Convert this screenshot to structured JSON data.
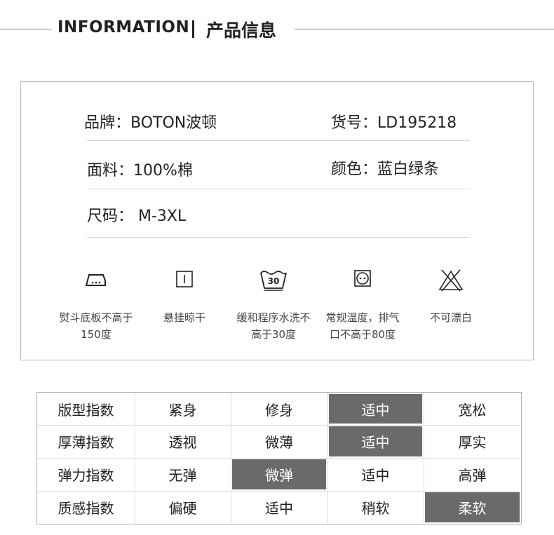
{
  "header": {
    "title_en": "INFORMATION",
    "title_cn": "产品信息"
  },
  "info": {
    "brand": "品牌：BOTON波顿",
    "item_no": "货号：LD195218",
    "fabric": "面料：100%棉",
    "color": "颜色：蓝白绿条",
    "size": "尺码： M-3XL"
  },
  "care": [
    {
      "icon": "iron-icon",
      "line1": "熨斗底板不高于",
      "line2": "150度"
    },
    {
      "icon": "hang-dry-icon",
      "line1": "悬挂晾干",
      "line2": ""
    },
    {
      "icon": "wash-30-icon",
      "line1": "缓和程序水洗不",
      "line2": "高于30度",
      "wash_temp": "30"
    },
    {
      "icon": "tumble-dry-icon",
      "line1": "常规温度，排气",
      "line2": "口不高于80度"
    },
    {
      "icon": "no-bleach-icon",
      "line1": "不可漂白",
      "line2": ""
    }
  ],
  "index_table": {
    "rows": [
      {
        "label": "版型指数",
        "options": [
          "紧身",
          "修身",
          "适中",
          "宽松"
        ],
        "selected": 2
      },
      {
        "label": "厚薄指数",
        "options": [
          "透视",
          "微薄",
          "适中",
          "厚实"
        ],
        "selected": 2
      },
      {
        "label": "弹力指数",
        "options": [
          "无弹",
          "微弹",
          "适中",
          "高弹"
        ],
        "selected": 1
      },
      {
        "label": "质感指数",
        "options": [
          "偏硬",
          "适中",
          "稍软",
          "柔软"
        ],
        "selected": 3
      }
    ],
    "highlight_color": "#6a6a6a"
  }
}
